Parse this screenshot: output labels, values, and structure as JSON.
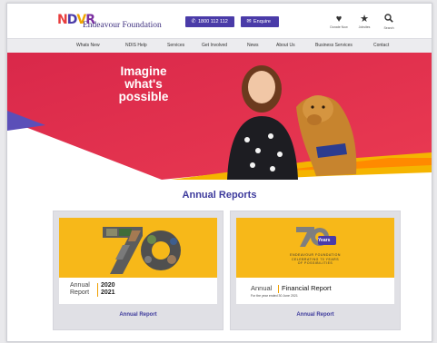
{
  "header": {
    "logo_mark": "NDVR",
    "logo_name": "Endeavour Foundation",
    "call_label": "1800 112 112",
    "enquire_label": "Enquire",
    "donate_label": "Donate Now",
    "favourites_label": "Jobsites",
    "search_label": "Search"
  },
  "nav": {
    "items": [
      "Whats New",
      "NDIS Help",
      "Services",
      "Get Involved",
      "News",
      "About Us",
      "Business Services",
      "Contact"
    ]
  },
  "hero": {
    "headline_line1": "Imagine",
    "headline_line2": "what's",
    "headline_line3": "possible"
  },
  "section": {
    "title": "Annual Reports"
  },
  "cards": [
    {
      "big_number": "70",
      "report_word1": "Annual",
      "report_word2": "Report",
      "year1": "2020",
      "year2": "2021",
      "link": "Annual Report"
    },
    {
      "big_number": "70",
      "badge": "Years",
      "tagline1": "ENDEAVOUR FOUNDATION",
      "tagline2": "CELEBRATING 70 YEARS",
      "tagline3": "OF POSSIBILITIES",
      "report_word": "Annual",
      "report_title": "Financial Report",
      "report_sub": "For the year ended 30 June 2021",
      "link": "Annual Report"
    }
  ],
  "colors": {
    "brand_purple": "#4a3ba8",
    "hero_red": "#e02c4a",
    "hero_yellow": "#f5b400",
    "card_yellow": "#f7b819"
  }
}
